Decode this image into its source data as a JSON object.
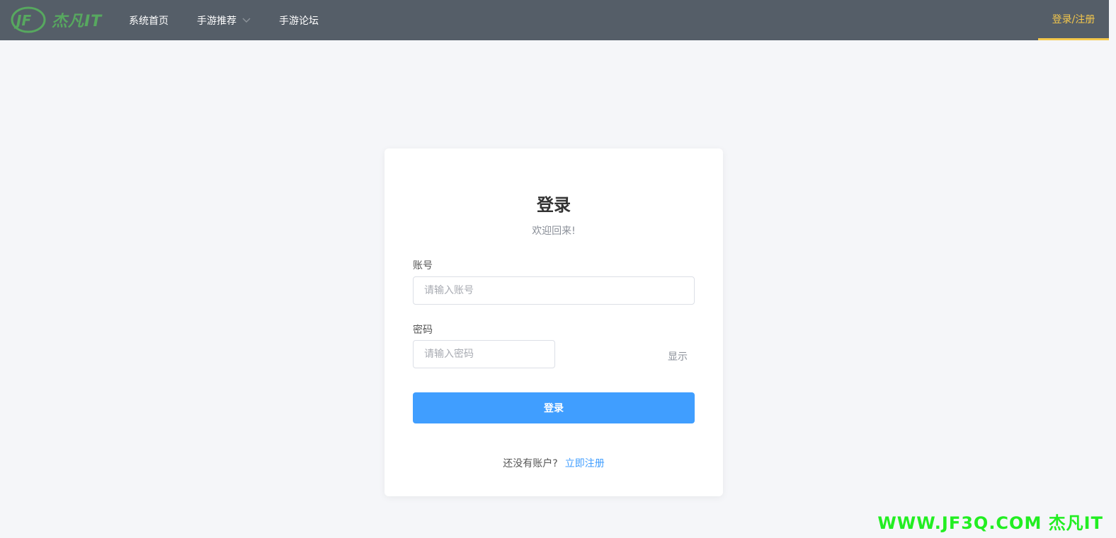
{
  "header": {
    "logo_text": "杰凡IT",
    "nav": [
      {
        "label": "系统首页"
      },
      {
        "label": "手游推荐"
      },
      {
        "label": "手游论坛"
      }
    ],
    "login_register": "登录/注册"
  },
  "login": {
    "title": "登录",
    "subtitle": "欢迎回来!",
    "account_label": "账号",
    "account_placeholder": "请输入账号",
    "password_label": "密码",
    "password_placeholder": "请输入密码",
    "show_password": "显示",
    "submit": "登录",
    "no_account": "还没有账户?",
    "register_now": "立即注册"
  },
  "watermark": "WWW.JF3Q.COM 杰凡IT",
  "colors": {
    "topbar": "#555e68",
    "accent_yellow": "#f5c84b",
    "primary_blue": "#409eff",
    "logo_green": "#57a85f",
    "watermark_green": "#22ee22"
  }
}
